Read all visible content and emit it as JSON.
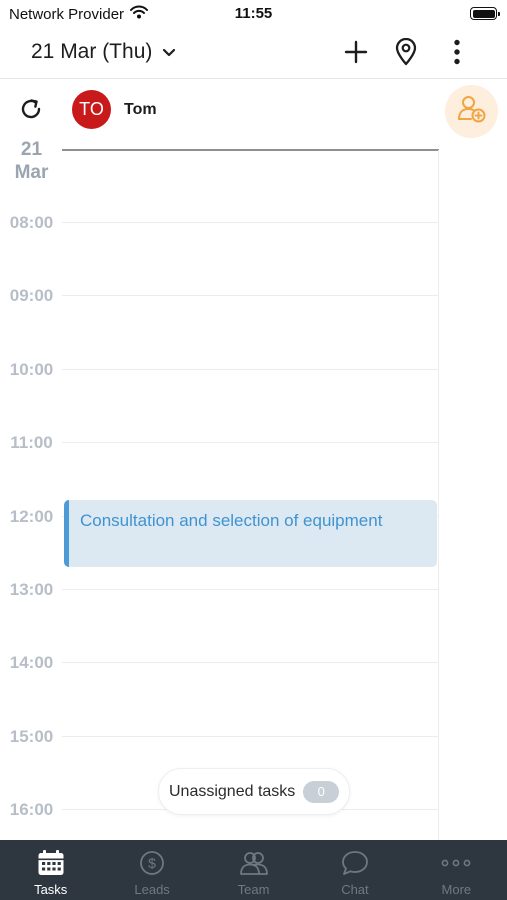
{
  "status_bar": {
    "carrier": "Network Provider",
    "time": "11:55",
    "battery_level": 1.0
  },
  "header": {
    "date_label": "21 Mar (Thu)"
  },
  "user": {
    "initials": "TO",
    "name": "Tom",
    "avatar_color": "#c8191b"
  },
  "calendar": {
    "day": {
      "number": "21",
      "month": "Mar"
    },
    "hours": [
      "08:00",
      "09:00",
      "10:00",
      "11:00",
      "12:00",
      "13:00",
      "14:00",
      "15:00",
      "16:00"
    ],
    "events": [
      {
        "title": "Consultation and selection of equipment",
        "color": "#4c9bd6"
      }
    ]
  },
  "unassigned": {
    "label": "Unassigned tasks",
    "count": "0"
  },
  "tab_bar": {
    "items": [
      {
        "label": "Tasks",
        "icon": "calendar-icon",
        "active": true
      },
      {
        "label": "Leads",
        "icon": "dollar-coin-icon",
        "active": false
      },
      {
        "label": "Team",
        "icon": "team-icon",
        "active": false
      },
      {
        "label": "Chat",
        "icon": "chat-bubble-icon",
        "active": false
      },
      {
        "label": "More",
        "icon": "more-dots-icon",
        "active": false
      }
    ]
  },
  "colors": {
    "accent": "#4c9bd6",
    "tab_bar_bg": "#2e3740",
    "add_user_icon": "#f0a542"
  }
}
